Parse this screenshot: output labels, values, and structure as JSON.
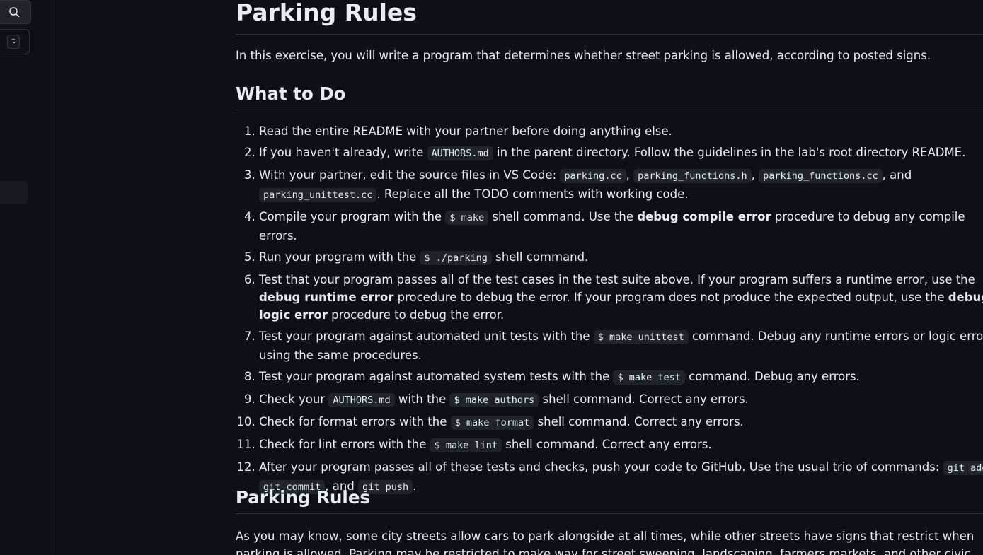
{
  "sidebar": {
    "search_icon": "search-icon",
    "shortcut_key": "t"
  },
  "page": {
    "title": "Parking Rules",
    "intro": "In this exercise, you will write a program that determines whether street parking is allowed, according to posted signs.",
    "section_what_to_do": "What to Do",
    "section_parking_rules": "Parking Rules",
    "parking_rules_text": "As you may know, some city streets allow cars to park alongside at all times, while other streets have signs that restrict when parking is allowed. Parking may be restricted to make way for street sweeping, landscaping, farmers markets, and other civic routines."
  },
  "steps": {
    "s1": {
      "t1": "Read the entire README with your partner before doing anything else."
    },
    "s2": {
      "t1": "If you haven't already, write ",
      "c1": "AUTHORS.md",
      "t2": " in the parent directory. Follow the guidelines in the lab's root directory README."
    },
    "s3": {
      "t1": "With your partner, edit the source files in VS Code: ",
      "c1": "parking.cc",
      "t2": ", ",
      "c2": "parking_functions.h",
      "t3": ", ",
      "c3": "parking_functions.cc",
      "t4": ", and ",
      "c4": "parking_unittest.cc",
      "t5": ". Replace all the TODO comments with working code."
    },
    "s4": {
      "t1": "Compile your program with the ",
      "c1": "$ make",
      "t2": " shell command. Use the ",
      "b1": "debug compile error",
      "t3": " procedure to debug any compile errors."
    },
    "s5": {
      "t1": "Run your program with the ",
      "c1": "$ ./parking",
      "t2": " shell command."
    },
    "s6": {
      "t1": "Test that your program passes all of the test cases in the test suite above. If your program suffers a runtime error, use the ",
      "b1": "debug runtime error",
      "t2": " procedure to debug the error. If your program does not produce the expected output, use the ",
      "b2": "debug logic error",
      "t3": " procedure to debug the error."
    },
    "s7": {
      "t1": "Test your program against automated unit tests with the ",
      "c1": "$ make unittest",
      "t2": " command. Debug any runtime errors or logic errors using the same procedures."
    },
    "s8": {
      "t1": "Test your program against automated system tests with the ",
      "c1": "$ make test",
      "t2": " command. Debug any errors."
    },
    "s9": {
      "t1": "Check your ",
      "c1": "AUTHORS.md",
      "t2": " with the ",
      "c2": "$ make authors",
      "t3": " shell command. Correct any errors."
    },
    "s10": {
      "t1": "Check for format errors with the ",
      "c1": "$ make format",
      "t2": " shell command. Correct any errors."
    },
    "s11": {
      "t1": "Check for lint errors with the ",
      "c1": "$ make lint",
      "t2": " shell command. Correct any errors."
    },
    "s12": {
      "t1": "After your program passes all of these tests and checks, push your code to GitHub. Use the usual trio of commands: ",
      "c1": "git add",
      "t2": ", ",
      "c2": "git commit",
      "t3": ", and ",
      "c3": "git push",
      "t4": "."
    }
  }
}
